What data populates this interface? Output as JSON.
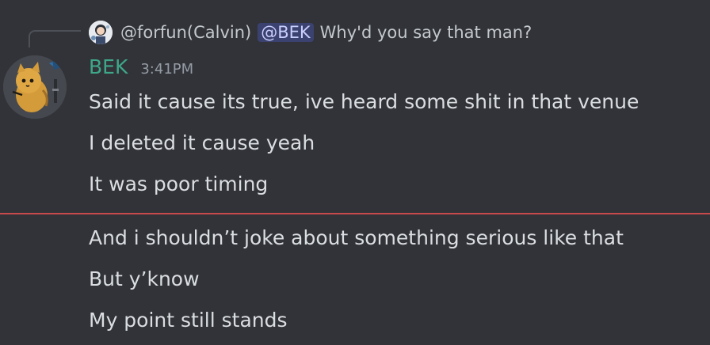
{
  "reply": {
    "author": "@forfun(Calvin)",
    "mention": "@BEK",
    "text": "Why'd you say that man?"
  },
  "message": {
    "username": "BEK",
    "username_color": "#3ea78a",
    "timestamp": "3:41PM",
    "lines": [
      "Said it cause its true, ive heard some shit in that venue",
      "I deleted it cause yeah",
      "It was poor timing"
    ]
  },
  "new_messages_divider_color": "#c84a4a",
  "after_divider": {
    "lines": [
      "And i shouldn’t joke about something serious like that",
      "But y’know",
      "My point still stands"
    ]
  },
  "theme": {
    "background": "#313338",
    "mention_bg": "#3c4270",
    "mention_text": "#c9cdfb"
  }
}
